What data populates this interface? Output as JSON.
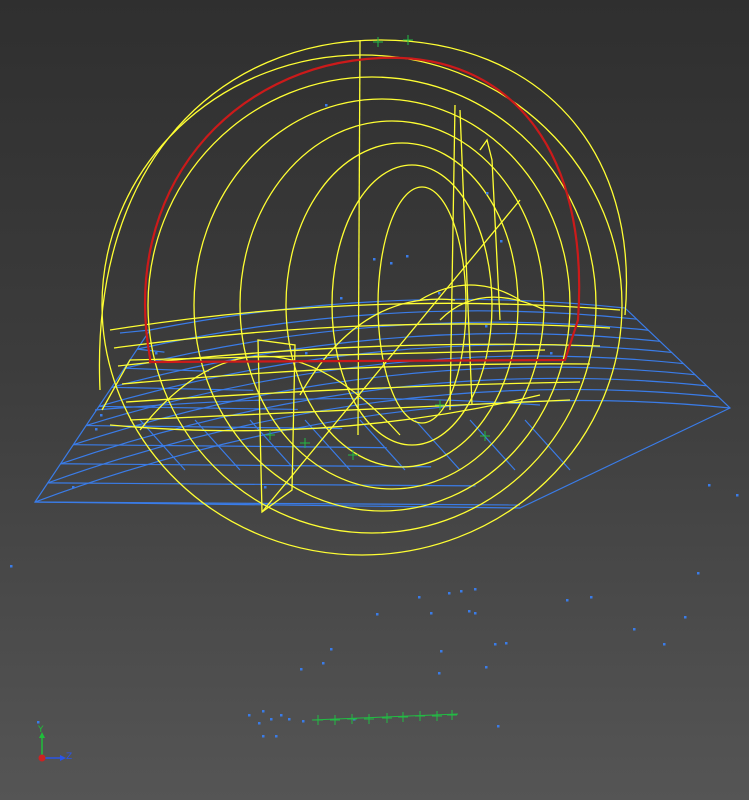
{
  "scene": {
    "background_top": "#2f2f2f",
    "background_bottom": "#555555"
  },
  "colors": {
    "dome_wire": "#ffff33",
    "dome_rim": "#cc1a1a",
    "ground_wire": "#3a7ce8",
    "points": "#3a7ce8",
    "markers": "#22bb44"
  },
  "triad": {
    "y_label": "Y",
    "z_label": "Z",
    "y_color": "#1fbf3a",
    "z_color": "#2a55e8",
    "x_color": "#cc2222"
  }
}
